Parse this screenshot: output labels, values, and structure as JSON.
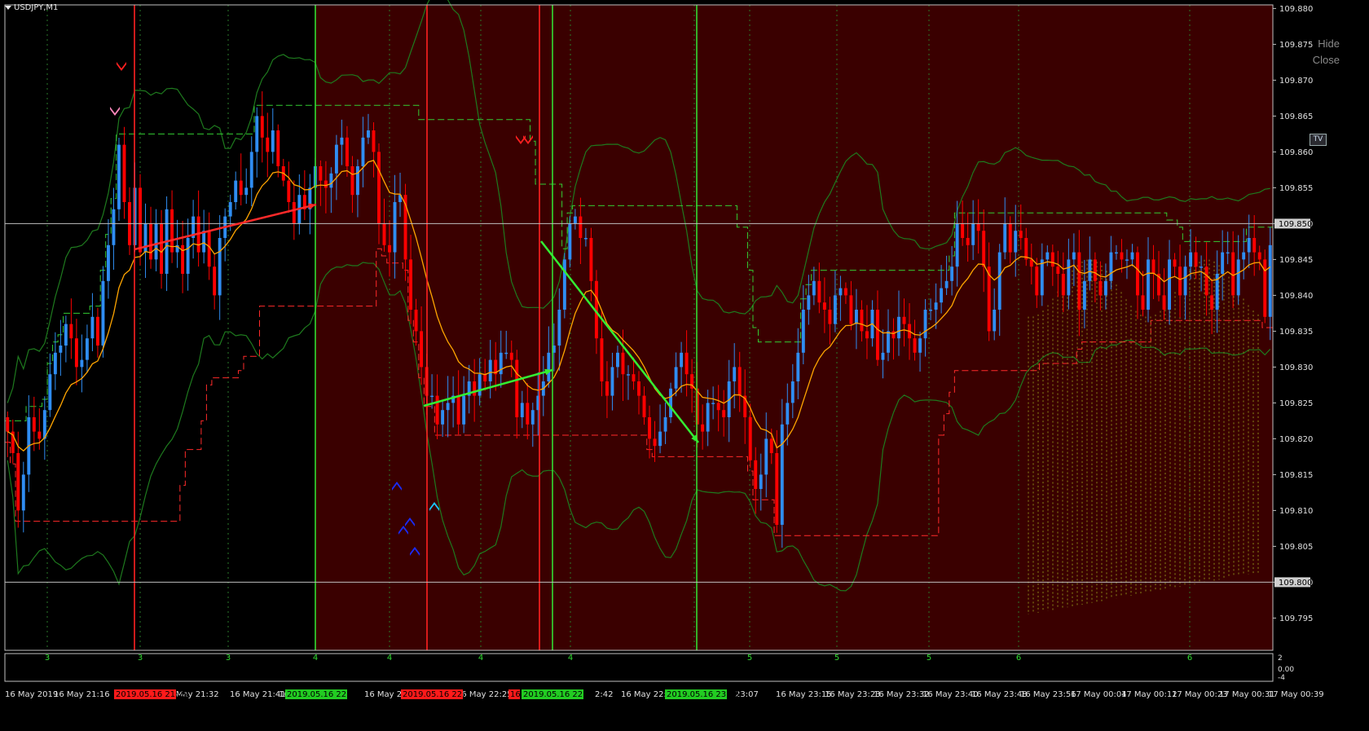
{
  "window": {
    "title": "USDJPY,M1"
  },
  "overlay": {
    "hide_label": "Hide",
    "close_label": "Close",
    "tv_label": "TV"
  },
  "colors": {
    "background": "#000000",
    "session_shade": "#3a0000",
    "bull_candle": "#2f8df2",
    "bear_candle": "#ff0000",
    "ma_line": "#ffa500",
    "band_line": "#1e7a1e",
    "upper_channel": "#33cc33",
    "lower_channel": "#ff2a2a",
    "grid": "#2a7a2a",
    "axis_text": "#e0e0e0"
  },
  "chart_data": {
    "type": "candlestick",
    "symbol": "USDJPY",
    "timeframe": "M1",
    "y_range": [
      109.7905,
      109.8805
    ],
    "y_ticks": [
      "109.880",
      "109.875",
      "109.870",
      "109.865",
      "109.860",
      "109.855",
      "109.850",
      "109.845",
      "109.840",
      "109.835",
      "109.830",
      "109.825",
      "109.820",
      "109.815",
      "109.810",
      "109.805",
      "109.800",
      "109.795"
    ],
    "price_marker_levels": [
      "109.850",
      "109.800"
    ],
    "x_labels": [
      "16 May 2019",
      "16 May 21:16",
      "16 May 21:32",
      "16 May 21:41",
      "16 May 2",
      "16 May 22:06",
      "16 May 22:25",
      "2:42",
      "16 May 22:50",
      "16 M",
      "23:07",
      "16 May 23:15",
      "16 May 23:23",
      "16 May 23:32",
      "16 May 23:40",
      "16 May 23:48",
      "16 May 23:56",
      "17 May 00:04",
      "17 May 00:12",
      "17 May 00:23",
      "17 May 00:31",
      "17 May 00:39"
    ],
    "highlighted_times": [
      {
        "label": "2019.05.16 21:29",
        "color": "red"
      },
      {
        "label": "2019.05.16 22:00",
        "color": "green"
      },
      {
        "label": "2019.05.16 22:21",
        "color": "red"
      },
      {
        "label": "16",
        "color": "red"
      },
      {
        "label": "2019.05.16 22:42",
        "color": "green"
      },
      {
        "label": "2019.05.16 23:06",
        "color": "green"
      }
    ],
    "vertical_markers": [
      {
        "color": "red"
      },
      {
        "color": "green"
      },
      {
        "color": "red"
      },
      {
        "color": "red"
      },
      {
        "color": "green"
      },
      {
        "color": "green"
      }
    ],
    "session_numbers": [
      "3",
      "3",
      "3",
      "4",
      "4",
      "4",
      "4",
      "5",
      "5",
      "5",
      "6",
      "6"
    ],
    "indicator_window": {
      "ticks": [
        "2",
        "0.00",
        "-4"
      ]
    },
    "closes": [
      109.821,
      109.818,
      109.81,
      109.815,
      109.823,
      109.821,
      109.82,
      109.824,
      109.829,
      109.832,
      109.833,
      109.836,
      109.834,
      109.83,
      109.831,
      109.834,
      109.837,
      109.833,
      109.842,
      109.847,
      109.852,
      109.861,
      109.853,
      109.847,
      109.855,
      109.846,
      109.85,
      109.845,
      109.85,
      109.843,
      109.852,
      109.846,
      109.847,
      109.843,
      109.848,
      109.851,
      109.846,
      109.849,
      109.844,
      109.84,
      109.848,
      109.851,
      109.853,
      109.856,
      109.854,
      109.855,
      109.86,
      109.865,
      109.862,
      109.86,
      109.863,
      109.858,
      109.856,
      109.853,
      109.85,
      109.854,
      109.852,
      109.855,
      109.858,
      109.856,
      109.855,
      109.857,
      109.861,
      109.862,
      109.858,
      109.854,
      109.858,
      109.862,
      109.863,
      109.86,
      109.85,
      109.847,
      109.846,
      109.853,
      109.854,
      109.845,
      109.838,
      109.835,
      109.83,
      109.826,
      109.826,
      109.822,
      109.824,
      109.825,
      109.826,
      109.822,
      109.826,
      109.828,
      109.826,
      109.829,
      109.828,
      109.831,
      109.829,
      109.832,
      109.832,
      109.831,
      109.823,
      109.825,
      109.822,
      109.824,
      109.826,
      109.828,
      109.832,
      109.833,
      109.838,
      109.845,
      109.85,
      109.851,
      109.848,
      109.848,
      109.842,
      109.834,
      109.828,
      109.826,
      109.83,
      109.832,
      109.829,
      109.829,
      109.828,
      109.826,
      109.823,
      109.82,
      109.819,
      109.821,
      109.823,
      109.827,
      109.83,
      109.832,
      109.829,
      109.827,
      109.822,
      109.821,
      109.825,
      109.825,
      109.824,
      109.823,
      109.828,
      109.83,
      109.826,
      109.823,
      109.817,
      109.813,
      109.815,
      109.82,
      109.818,
      109.808,
      109.822,
      109.825,
      109.828,
      109.832,
      109.838,
      109.84,
      109.842,
      109.839,
      109.838,
      109.836,
      109.84,
      109.841,
      109.84,
      109.836,
      109.838,
      109.835,
      109.834,
      109.838,
      109.831,
      109.832,
      109.835,
      109.834,
      109.837,
      109.836,
      109.834,
      109.832,
      109.834,
      109.838,
      109.838,
      109.839,
      109.841,
      109.842,
      109.844,
      109.85,
      109.848,
      109.847,
      109.85,
      109.849,
      109.844,
      109.835,
      109.838,
      109.846,
      109.85,
      109.846,
      109.849,
      109.848,
      109.845,
      109.844,
      109.84,
      109.845,
      109.846,
      109.844,
      109.843,
      109.84,
      109.845,
      109.846,
      109.838,
      109.842,
      109.845,
      109.842,
      109.84,
      109.842,
      109.846,
      109.846,
      109.845,
      109.845,
      109.846,
      109.84,
      109.838,
      109.845,
      109.843,
      109.84,
      109.838,
      109.845,
      109.844,
      109.84,
      109.844,
      109.846,
      109.844,
      109.844,
      109.84,
      109.838,
      109.843,
      109.846,
      109.846,
      109.84,
      109.845,
      109.846,
      109.848,
      109.846,
      109.845,
      109.837,
      109.847
    ]
  }
}
